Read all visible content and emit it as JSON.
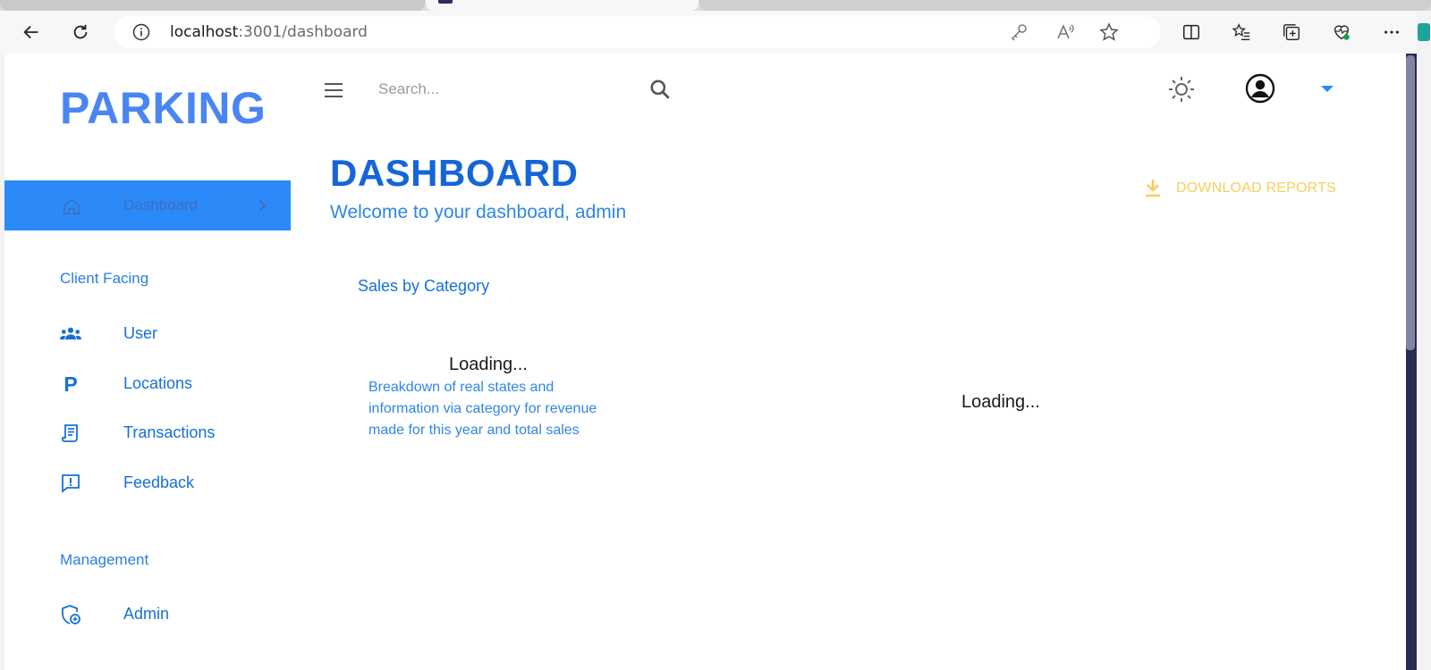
{
  "browser": {
    "url_host": "localhost",
    "url_rest": ":3001/dashboard"
  },
  "header": {
    "search_placeholder": "Search..."
  },
  "sidebar": {
    "brand": "PARKING",
    "active_item": "Dashboard",
    "sections": [
      {
        "title": "Client Facing",
        "items": [
          {
            "label": "User",
            "icon": "users-icon"
          },
          {
            "label": "Locations",
            "icon": "parking-icon"
          },
          {
            "label": "Transactions",
            "icon": "receipt-icon"
          },
          {
            "label": "Feedback",
            "icon": "feedback-icon"
          }
        ]
      },
      {
        "title": "Management",
        "items": [
          {
            "label": "Admin",
            "icon": "admin-shield-icon"
          }
        ]
      }
    ]
  },
  "main": {
    "title": "DASHBOARD",
    "subtitle": "Welcome to your dashboard, admin",
    "download_label": "DOWNLOAD REPORTS",
    "card": {
      "title": "Sales by Category",
      "loading": "Loading...",
      "description": "Breakdown of real states and information via category for revenue made for this year and total sales"
    },
    "secondary_loading": "Loading..."
  },
  "colors": {
    "accent": "#2b8af7",
    "brand": "#4a86f2",
    "title": "#1565d8",
    "download": "#f5cf5c"
  }
}
